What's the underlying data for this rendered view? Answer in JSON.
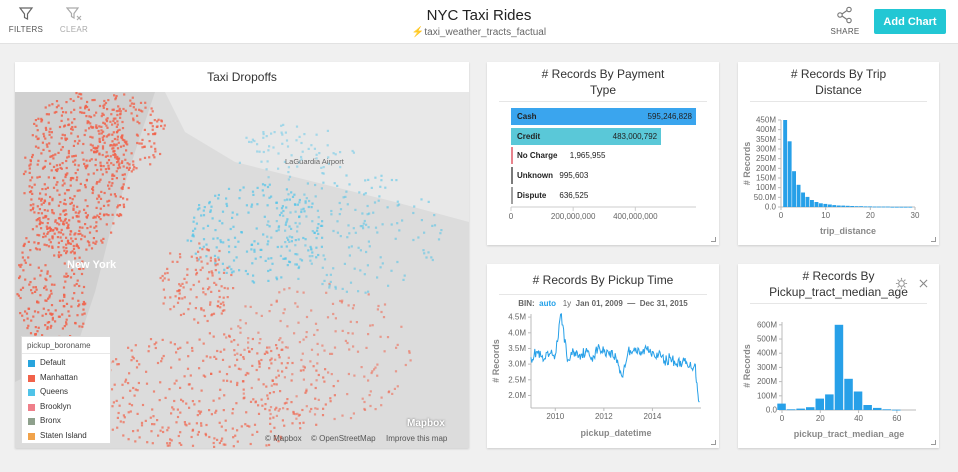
{
  "header": {
    "title": "NYC Taxi Rides",
    "subtitle": "taxi_weather_tracts_factual",
    "filters_label": "FILTERS",
    "clear_label": "CLEAR",
    "share_label": "SHARE",
    "add_chart_label": "Add Chart",
    "accent_color": "#22c7d4"
  },
  "map_card": {
    "title": "Taxi Dropoffs",
    "labels": {
      "borough": "New York",
      "airport": "LaGuardia Airport"
    },
    "legend": {
      "title": "pickup_boroname",
      "items": [
        {
          "label": "Default",
          "color": "#27a4dd"
        },
        {
          "label": "Manhattan",
          "color": "#f1624a"
        },
        {
          "label": "Queens",
          "color": "#4fc3e8"
        },
        {
          "label": "Brooklyn",
          "color": "#ef7f8a"
        },
        {
          "label": "Bronx",
          "color": "#8ea08c"
        },
        {
          "label": "Staten Island",
          "color": "#f1a34b"
        }
      ]
    },
    "attribution": {
      "mapbox": "© Mapbox",
      "osm": "© OpenStreetMap",
      "improve": "Improve this map",
      "logo": "Mapbox"
    }
  },
  "payment_card": {
    "title_line1": "# Records By Payment",
    "title_line2": "Type",
    "x_ticks": [
      "0",
      "200,000,000",
      "400,000,000"
    ],
    "chart_data": {
      "type": "bar",
      "orientation": "horizontal",
      "categories": [
        "Cash",
        "Credit",
        "No Charge",
        "Unknown",
        "Dispute"
      ],
      "values": [
        595246828,
        483000792,
        1965955,
        995603,
        636525
      ],
      "value_labels": [
        "595,246,828",
        "483,000,792",
        "1,965,955",
        "995,603",
        "636,525"
      ],
      "colors": [
        "#3aa5ee",
        "#5ac8d8",
        "#e8828c",
        "#7a7a7a",
        "#a0a0a0"
      ],
      "xlim": [
        0,
        595246828
      ]
    }
  },
  "trip_card": {
    "title_line1": "# Records By Trip",
    "title_line2": "Distance",
    "x_label": "trip_distance",
    "y_label": "# Records",
    "y_ticks": [
      "450M",
      "400M",
      "350M",
      "300M",
      "250M",
      "200M",
      "150M",
      "100M",
      "50.0M",
      "0.0"
    ],
    "x_ticks": [
      "0",
      "10",
      "20",
      "30"
    ],
    "chart_data": {
      "type": "bar",
      "xlabel": "trip_distance",
      "ylabel": "# Records",
      "x": [
        1,
        2,
        3,
        4,
        5,
        6,
        7,
        8,
        9,
        10,
        11,
        12,
        13,
        14,
        15,
        16,
        17,
        18,
        19,
        20,
        21,
        22,
        23,
        24,
        25,
        26,
        27,
        28,
        29
      ],
      "values": [
        450,
        340,
        185,
        115,
        75,
        52,
        36,
        26,
        19,
        16,
        13,
        10,
        8,
        7,
        6,
        5,
        4,
        4,
        3,
        3,
        2,
        2,
        2,
        2,
        1,
        1,
        1,
        1,
        1
      ],
      "unit": "M",
      "xlim": [
        0,
        30
      ],
      "ylim": [
        0,
        450
      ]
    }
  },
  "pickup_time_card": {
    "title": "# Records By Pickup Time",
    "bin_label": "BIN:",
    "bin_auto": "auto",
    "bin_1y": "1y",
    "date_from": "Jan 01, 2009",
    "date_sep": "—",
    "date_to": "Dec 31, 2015",
    "x_label": "pickup_datetime",
    "y_label": "# Records",
    "y_ticks": [
      "4.5M",
      "4.0M",
      "3.5M",
      "3.0M",
      "2.5M",
      "2.0M"
    ],
    "x_ticks": [
      "2010",
      "2012",
      "2014"
    ],
    "chart_data": {
      "type": "line",
      "xlabel": "pickup_datetime",
      "ylabel": "# Records",
      "x": [
        "2009-01",
        "2009-04",
        "2009-07",
        "2009-10",
        "2010-01",
        "2010-04",
        "2010-07",
        "2010-10",
        "2011-01",
        "2011-04",
        "2011-07",
        "2011-10",
        "2012-01",
        "2012-04",
        "2012-07",
        "2012-10",
        "2013-01",
        "2013-04",
        "2013-07",
        "2013-10",
        "2014-01",
        "2014-04",
        "2014-07",
        "2014-10",
        "2015-01",
        "2015-04",
        "2015-07",
        "2015-10",
        "2015-12"
      ],
      "values": [
        3.2,
        3.4,
        3.1,
        3.3,
        3.3,
        4.6,
        3.1,
        3.4,
        3.3,
        3.4,
        3.2,
        3.5,
        3.4,
        3.4,
        3.2,
        2.6,
        3.4,
        3.5,
        3.3,
        3.5,
        3.4,
        3.3,
        3.1,
        3.2,
        3.0,
        3.1,
        2.9,
        3.0,
        1.8
      ],
      "unit": "M",
      "ylim": [
        1.6,
        4.6
      ]
    }
  },
  "median_age_card": {
    "title_line1": "# Records By",
    "title_line2": "Pickup_tract_median_age",
    "x_label": "pickup_tract_median_age",
    "y_label": "# Records",
    "y_ticks": [
      "600M",
      "500M",
      "400M",
      "300M",
      "200M",
      "100M",
      "0.0"
    ],
    "x_ticks": [
      "0",
      "20",
      "40",
      "60"
    ],
    "chart_data": {
      "type": "bar",
      "xlabel": "pickup_tract_median_age",
      "ylabel": "# Records",
      "x": [
        0,
        5,
        10,
        15,
        20,
        25,
        30,
        35,
        40,
        45,
        50,
        55,
        60,
        65
      ],
      "values": [
        45,
        5,
        10,
        20,
        80,
        110,
        600,
        220,
        130,
        35,
        15,
        5,
        2,
        0
      ],
      "unit": "M",
      "xlim": [
        0,
        70
      ],
      "ylim": [
        0,
        620
      ]
    }
  }
}
